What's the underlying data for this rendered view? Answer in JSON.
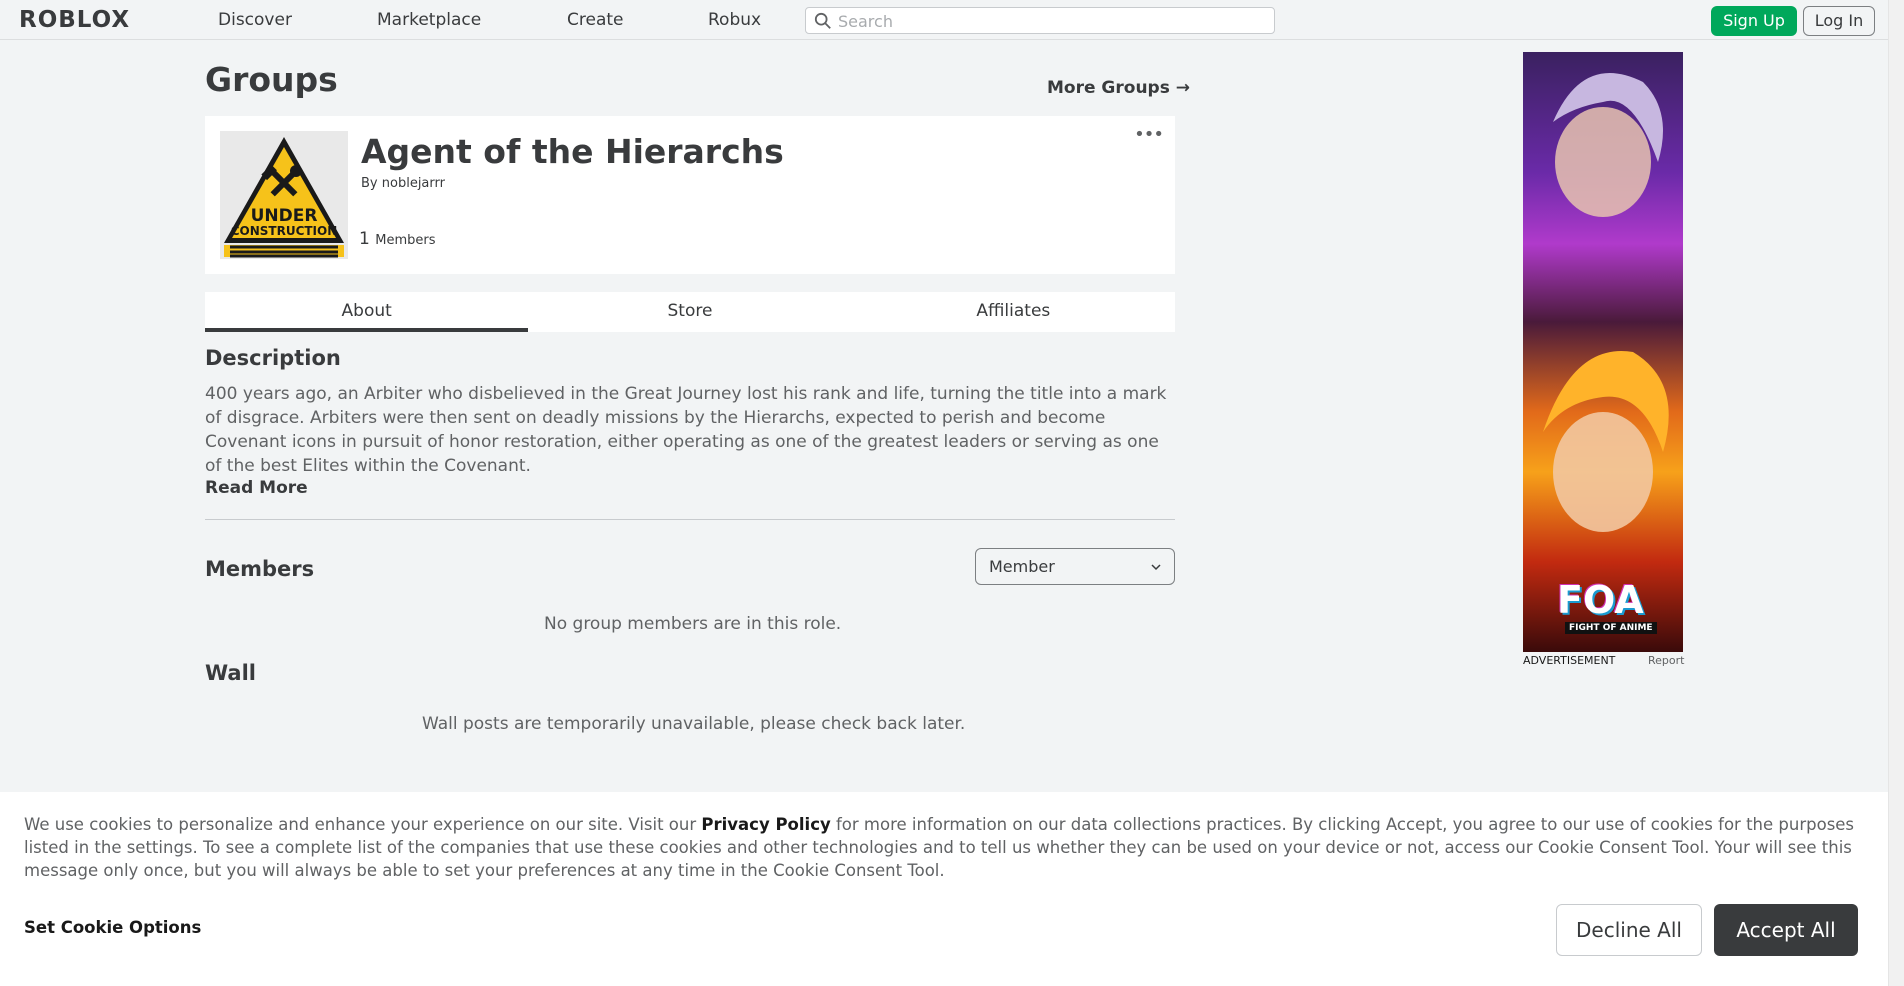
{
  "nav": {
    "logo": "ROBLOX",
    "links": [
      "Discover",
      "Marketplace",
      "Create",
      "Robux"
    ],
    "search_placeholder": "Search",
    "signup_label": "Sign Up",
    "login_label": "Log In"
  },
  "page": {
    "title": "Groups",
    "more_groups": "More Groups →"
  },
  "group": {
    "name": "Agent of the Hierarchs",
    "by_label": "By",
    "owner": "noblejarrr",
    "member_count": "1",
    "members_label": "Members",
    "emblem_text_1": "UNDER",
    "emblem_text_2": "CONSTRUCTION"
  },
  "tabs": [
    "About",
    "Store",
    "Affiliates"
  ],
  "active_tab": "About",
  "description": {
    "heading": "Description",
    "text": "400 years ago, an Arbiter who disbelieved in the Great Journey lost his rank and life, turning the title into a mark of disgrace. Arbiters were then sent on deadly missions by the Hierarchs, expected to perish and become Covenant icons in pursuit of honor restoration, either operating as one of the greatest leaders or serving as one of the best Elites within the Covenant.",
    "read_more": "Read More"
  },
  "members": {
    "heading": "Members",
    "role_selected": "Member",
    "empty_message": "No group members are in this role."
  },
  "wall": {
    "heading": "Wall",
    "message": "Wall posts are temporarily unavailable, please check back later."
  },
  "ad": {
    "label": "ADVERTISEMENT",
    "report": "Report",
    "brand": "FOA",
    "brand_sub": "FIGHT OF ANIME"
  },
  "cookie": {
    "text_before": "We use cookies to personalize and enhance your experience on our site. Visit our ",
    "privacy_link": "Privacy Policy",
    "text_after": " for more information on our data collections practices. By clicking Accept, you agree to our use of cookies for the purposes listed in the settings. To see a complete list of the companies that use these cookies and other technologies and to tell us whether they can be used on your device or not, access our Cookie Consent Tool. Your will see this message only once, but you will always be able to set your preferences at any time in the Cookie Consent Tool.",
    "set_options": "Set Cookie Options",
    "decline_label": "Decline All",
    "accept_label": "Accept All"
  },
  "colors": {
    "signup_green": "#00a85b",
    "text_dark": "#393b3d",
    "background": "#f2f4f5"
  }
}
